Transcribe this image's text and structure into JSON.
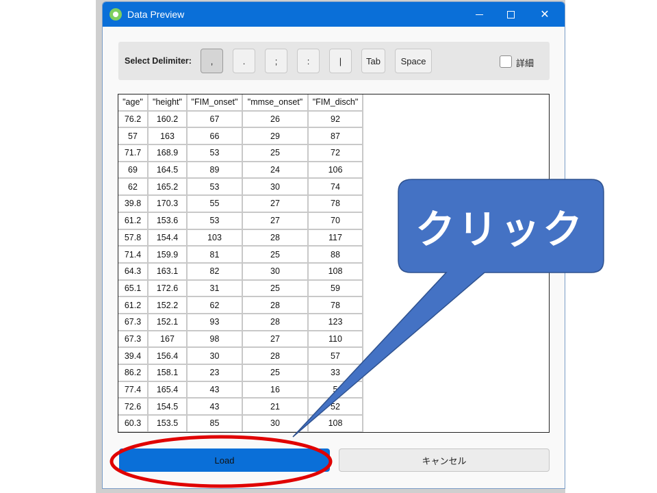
{
  "window": {
    "title": "Data Preview",
    "icon": "app-note-icon"
  },
  "delimiter": {
    "label": "Select Delimiter:",
    "options": [
      ",",
      ".",
      ";",
      ":",
      "|",
      "Tab",
      "Space"
    ],
    "selected": ",",
    "detail_label": "詳細",
    "detail_checked": false
  },
  "table": {
    "headers": [
      "\"age\"",
      "\"height\"",
      "\"FIM_onset\"",
      "\"mmse_onset\"",
      "\"FIM_disch\""
    ],
    "rows": [
      [
        "76.2",
        "160.2",
        "67",
        "26",
        "92"
      ],
      [
        "57",
        "163",
        "66",
        "29",
        "87"
      ],
      [
        "71.7",
        "168.9",
        "53",
        "25",
        "72"
      ],
      [
        "69",
        "164.5",
        "89",
        "24",
        "106"
      ],
      [
        "62",
        "165.2",
        "53",
        "30",
        "74"
      ],
      [
        "39.8",
        "170.3",
        "55",
        "27",
        "78"
      ],
      [
        "61.2",
        "153.6",
        "53",
        "27",
        "70"
      ],
      [
        "57.8",
        "154.4",
        "103",
        "28",
        "117"
      ],
      [
        "71.4",
        "159.9",
        "81",
        "25",
        "88"
      ],
      [
        "64.3",
        "163.1",
        "82",
        "30",
        "108"
      ],
      [
        "65.1",
        "172.6",
        "31",
        "25",
        "59"
      ],
      [
        "61.2",
        "152.2",
        "62",
        "28",
        "78"
      ],
      [
        "67.3",
        "152.1",
        "93",
        "28",
        "123"
      ],
      [
        "67.3",
        "167",
        "98",
        "27",
        "110"
      ],
      [
        "39.4",
        "156.4",
        "30",
        "28",
        "57"
      ],
      [
        "86.2",
        "158.1",
        "23",
        "25",
        "33"
      ],
      [
        "77.4",
        "165.4",
        "43",
        "16",
        "5"
      ],
      [
        "72.6",
        "154.5",
        "43",
        "21",
        "52"
      ],
      [
        "60.3",
        "153.5",
        "85",
        "30",
        "108"
      ]
    ]
  },
  "buttons": {
    "load": "Load",
    "cancel": "キャンセル"
  },
  "annotation": {
    "callout_text": "クリック",
    "callout_color": "#4472c4",
    "ellipse_color": "#e00000"
  },
  "colors": {
    "accent": "#0a6fd8"
  }
}
